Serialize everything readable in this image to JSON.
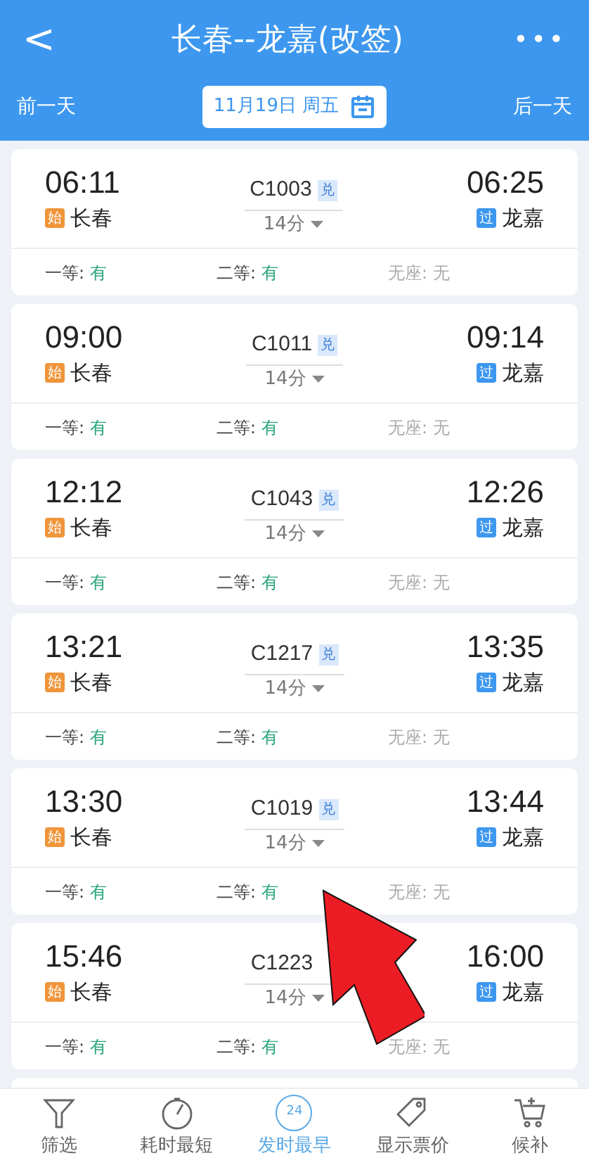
{
  "header": {
    "back": "<",
    "title": "长春--龙嘉(改签)",
    "more": "•••"
  },
  "date_bar": {
    "prev": "前一天",
    "date": "11月19日 周五",
    "next": "后一天"
  },
  "trains": [
    {
      "depart": "06:11",
      "from_badge": "始",
      "from": "长春",
      "number": "C1003",
      "number_badge": "兑",
      "duration": "14分",
      "arrive": "06:25",
      "to_badge": "过",
      "to": "龙嘉",
      "seats": [
        {
          "label": "一等:",
          "value": "有",
          "available": true
        },
        {
          "label": "二等:",
          "value": "有",
          "available": true
        },
        {
          "label": "无座:",
          "value": "无",
          "available": false
        }
      ]
    },
    {
      "depart": "09:00",
      "from_badge": "始",
      "from": "长春",
      "number": "C1011",
      "number_badge": "兑",
      "duration": "14分",
      "arrive": "09:14",
      "to_badge": "过",
      "to": "龙嘉",
      "seats": [
        {
          "label": "一等:",
          "value": "有",
          "available": true
        },
        {
          "label": "二等:",
          "value": "有",
          "available": true
        },
        {
          "label": "无座:",
          "value": "无",
          "available": false
        }
      ]
    },
    {
      "depart": "12:12",
      "from_badge": "始",
      "from": "长春",
      "number": "C1043",
      "number_badge": "兑",
      "duration": "14分",
      "arrive": "12:26",
      "to_badge": "过",
      "to": "龙嘉",
      "seats": [
        {
          "label": "一等:",
          "value": "有",
          "available": true
        },
        {
          "label": "二等:",
          "value": "有",
          "available": true
        },
        {
          "label": "无座:",
          "value": "无",
          "available": false
        }
      ]
    },
    {
      "depart": "13:21",
      "from_badge": "始",
      "from": "长春",
      "number": "C1217",
      "number_badge": "兑",
      "duration": "14分",
      "arrive": "13:35",
      "to_badge": "过",
      "to": "龙嘉",
      "seats": [
        {
          "label": "一等:",
          "value": "有",
          "available": true
        },
        {
          "label": "二等:",
          "value": "有",
          "available": true
        },
        {
          "label": "无座:",
          "value": "无",
          "available": false
        }
      ]
    },
    {
      "depart": "13:30",
      "from_badge": "始",
      "from": "长春",
      "number": "C1019",
      "number_badge": "兑",
      "duration": "14分",
      "arrive": "13:44",
      "to_badge": "过",
      "to": "龙嘉",
      "seats": [
        {
          "label": "一等:",
          "value": "有",
          "available": true
        },
        {
          "label": "二等:",
          "value": "有",
          "available": true
        },
        {
          "label": "无座:",
          "value": "无",
          "available": false
        }
      ]
    },
    {
      "depart": "15:46",
      "from_badge": "始",
      "from": "长春",
      "number": "C1223",
      "duration": "14分",
      "arrive": "16:00",
      "to_badge": "过",
      "to": "龙嘉",
      "seats": [
        {
          "label": "一等:",
          "value": "有",
          "available": true
        },
        {
          "label": "二等:",
          "value": "有",
          "available": true
        },
        {
          "label": "无座:",
          "value": "无",
          "available": false
        }
      ]
    }
  ],
  "bottom_tabs": [
    {
      "kind": "filter",
      "label": "筛选",
      "selected": false
    },
    {
      "kind": "timer",
      "label": "耗时最短",
      "selected": false
    },
    {
      "kind": "clock24",
      "label": "发时最早",
      "selected": true,
      "icon_text": "24"
    },
    {
      "kind": "tag",
      "label": "显示票价",
      "selected": false
    },
    {
      "kind": "cart",
      "label": "候补",
      "selected": false
    }
  ]
}
